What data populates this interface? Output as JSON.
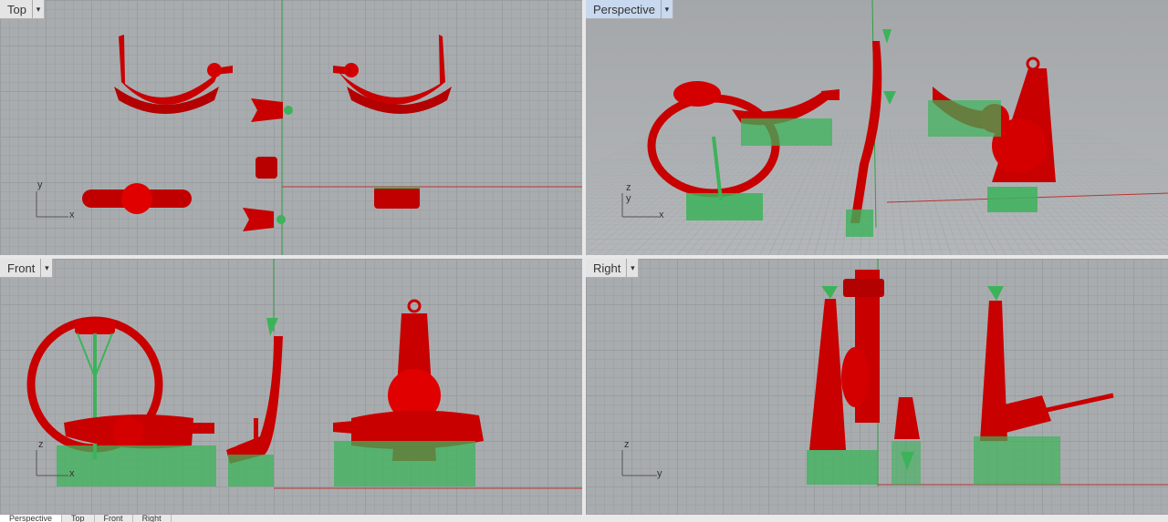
{
  "viewports": {
    "top": {
      "label": "Top",
      "axis_h": "x",
      "axis_v": "y"
    },
    "perspective": {
      "label": "Perspective",
      "axis_h": "x",
      "axis_v": "z",
      "axis_d": "y"
    },
    "front": {
      "label": "Front",
      "axis_h": "x",
      "axis_v": "z"
    },
    "right": {
      "label": "Right",
      "axis_h": "y",
      "axis_v": "z"
    }
  },
  "bottom_tabs": [
    "Perspective",
    "Top",
    "Front",
    "Right"
  ],
  "colors": {
    "model": "#d40000",
    "support": "#3cb35a",
    "grid": "#a9acaf"
  },
  "dropdown_glyph": "▾"
}
